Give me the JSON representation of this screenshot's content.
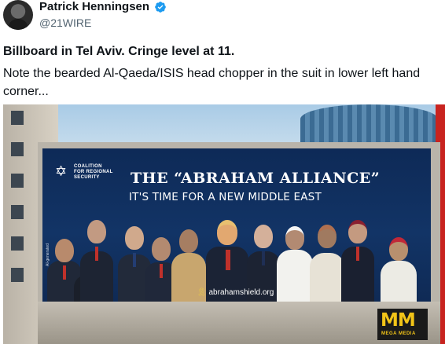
{
  "author": {
    "name": "Patrick Henningsen",
    "handle": "@21WIRE",
    "verified_badge_icon": "verified-icon",
    "badge_color": "#1d9bf0"
  },
  "tweet": {
    "title": "Billboard in Tel Aviv. Cringe level at 11.",
    "body": "Note the bearded Al-Qaeda/ISIS head chopper in the suit in lower left hand corner..."
  },
  "billboard": {
    "coalition_text": "COALITION FOR REGIONAL SECURITY",
    "headline": "THE “ABRAHAM ALLIANCE”",
    "subheadline": "IT'S TIME FOR A NEW MIDDLE EAST",
    "website": "abrahamshield.org",
    "side_credit": "AI-generated",
    "background_color": "#123466"
  },
  "watermark": {
    "logo": "MM",
    "text": "MEGA MEDIA",
    "color": "#f2c418"
  }
}
